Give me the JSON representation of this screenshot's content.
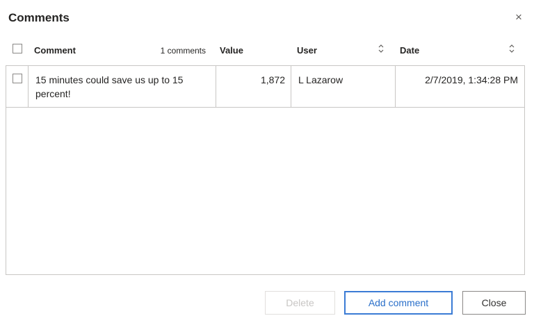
{
  "dialog": {
    "title": "Comments",
    "close_glyph": "×"
  },
  "table": {
    "comment_count": "1 comments",
    "headers": {
      "comment": "Comment",
      "value": "Value",
      "user": "User",
      "date": "Date"
    },
    "rows": [
      {
        "comment": "15 minutes could save us up to 15 percent!",
        "value": "1,872",
        "user": "L Lazarow",
        "date": "2/7/2019, 1:34:28 PM"
      }
    ]
  },
  "buttons": {
    "delete": "Delete",
    "add_comment": "Add comment",
    "close": "Close"
  },
  "icons": {
    "close": "close-icon",
    "sort": "sort-icon",
    "checkbox": "checkbox-icon"
  },
  "colors": {
    "accent": "#3a7bd5",
    "border": "#c8c6c4",
    "disabled_text": "#c8c6c4"
  }
}
